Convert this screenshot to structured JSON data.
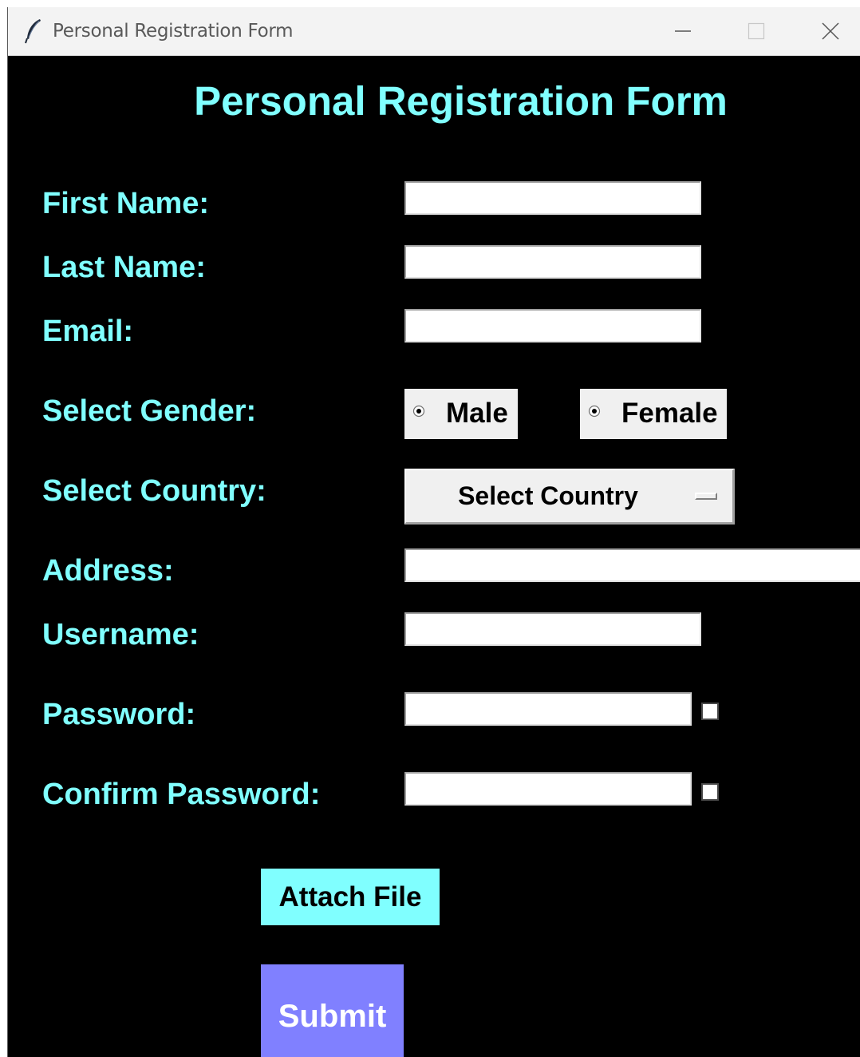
{
  "window": {
    "title": "Personal Registration Form",
    "controls": {
      "minimize": "minimize-icon",
      "maximize": "maximize-icon",
      "close": "close-icon"
    }
  },
  "form": {
    "title": "Personal Registration Form",
    "colors": {
      "background": "#000000",
      "label": "#80ffff",
      "attach_button": "#80ffff",
      "submit_button": "#8080ff"
    },
    "labels": {
      "first_name": "First Name:",
      "last_name": "Last Name:",
      "email": "Email:",
      "gender": "Select Gender:",
      "country": "Select Country:",
      "address": "Address:",
      "username": "Username:",
      "password": "Password:",
      "confirm_password": "Confirm Password:"
    },
    "values": {
      "first_name": "",
      "last_name": "",
      "email": "",
      "address": "",
      "username": "",
      "password": "",
      "confirm_password": ""
    },
    "gender_options": [
      "Male",
      "Female"
    ],
    "country_selected": "Select Country",
    "show_password_checked": false,
    "show_confirm_password_checked": false,
    "attach_label": "Attach File",
    "submit_label": "Submit"
  }
}
